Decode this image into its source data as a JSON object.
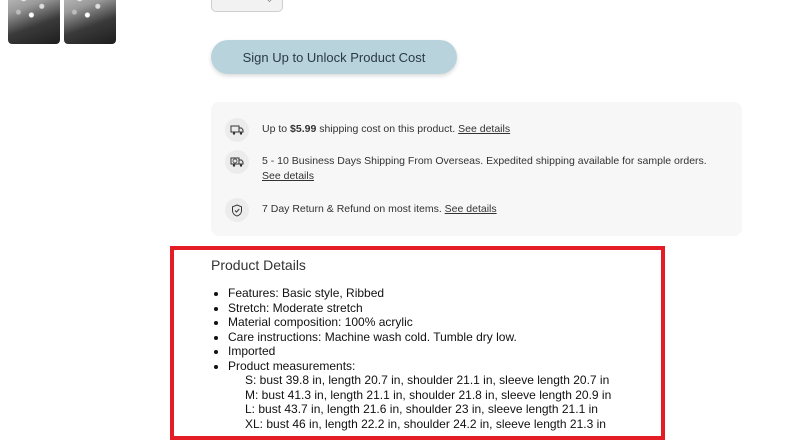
{
  "gallery": {
    "thumbnails": [
      "thumb-1",
      "thumb-2"
    ]
  },
  "quantity_select": {
    "icon": "chevron-down-icon"
  },
  "signup_button": {
    "label": "Sign Up to Unlock Product Cost"
  },
  "shipping": {
    "rows": [
      {
        "icon": "truck-icon",
        "prefix": "Up to ",
        "amount": "$5.99",
        "suffix": " shipping cost on this product. ",
        "link": "See details"
      },
      {
        "icon": "globe-truck-icon",
        "text": "5 - 10 Business Days Shipping From Overseas. Expedited shipping available for sample orders. ",
        "link": "See details"
      },
      {
        "icon": "shield-icon",
        "text": "7 Day Return & Refund on most items. ",
        "link": "See details"
      }
    ]
  },
  "product_details": {
    "title": "Product Details",
    "items": [
      "Features: Basic style, Ribbed",
      "Stretch: Moderate stretch",
      "Material composition: 100% acrylic",
      "Care instructions: Machine wash cold. Tumble dry low.",
      "Imported",
      "Product measurements:"
    ],
    "measurements": [
      "S: bust 39.8 in, length 20.7 in, shoulder 21.1 in, sleeve length 20.7 in",
      "M: bust 41.3 in, length 21.1 in, shoulder 21.8 in, sleeve length 20.9 in",
      "L: bust 43.7 in, length 21.6 in, shoulder 23 in, sleeve length 21.1 in",
      "XL: bust 46 in, length 22.2 in, shoulder 24.2 in, sleeve length 21.3 in"
    ]
  },
  "colors": {
    "highlight": "#e31c25",
    "button": "#b9d3dd"
  }
}
